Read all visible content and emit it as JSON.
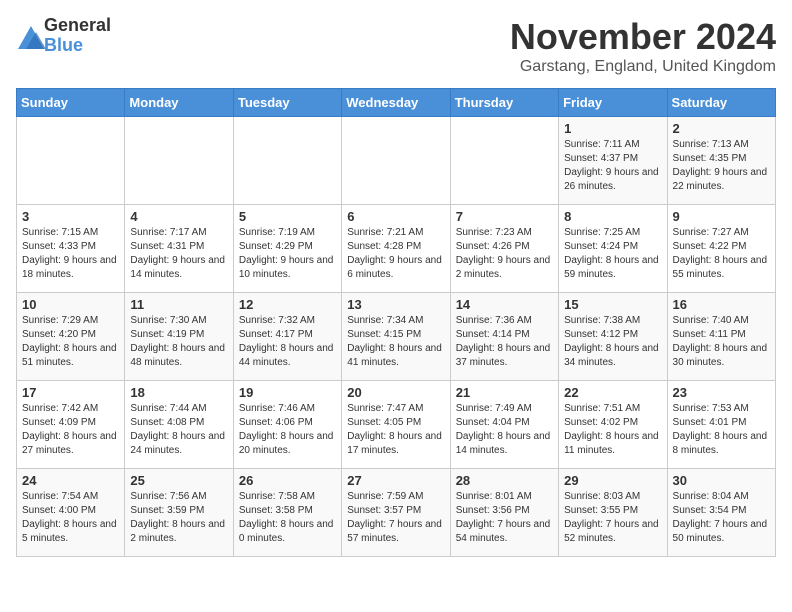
{
  "logo": {
    "general": "General",
    "blue": "Blue"
  },
  "header": {
    "month": "November 2024",
    "location": "Garstang, England, United Kingdom"
  },
  "weekdays": [
    "Sunday",
    "Monday",
    "Tuesday",
    "Wednesday",
    "Thursday",
    "Friday",
    "Saturday"
  ],
  "weeks": [
    [
      {
        "day": "",
        "sunrise": "",
        "sunset": "",
        "daylight": ""
      },
      {
        "day": "",
        "sunrise": "",
        "sunset": "",
        "daylight": ""
      },
      {
        "day": "",
        "sunrise": "",
        "sunset": "",
        "daylight": ""
      },
      {
        "day": "",
        "sunrise": "",
        "sunset": "",
        "daylight": ""
      },
      {
        "day": "",
        "sunrise": "",
        "sunset": "",
        "daylight": ""
      },
      {
        "day": "1",
        "sunrise": "Sunrise: 7:11 AM",
        "sunset": "Sunset: 4:37 PM",
        "daylight": "Daylight: 9 hours and 26 minutes."
      },
      {
        "day": "2",
        "sunrise": "Sunrise: 7:13 AM",
        "sunset": "Sunset: 4:35 PM",
        "daylight": "Daylight: 9 hours and 22 minutes."
      }
    ],
    [
      {
        "day": "3",
        "sunrise": "Sunrise: 7:15 AM",
        "sunset": "Sunset: 4:33 PM",
        "daylight": "Daylight: 9 hours and 18 minutes."
      },
      {
        "day": "4",
        "sunrise": "Sunrise: 7:17 AM",
        "sunset": "Sunset: 4:31 PM",
        "daylight": "Daylight: 9 hours and 14 minutes."
      },
      {
        "day": "5",
        "sunrise": "Sunrise: 7:19 AM",
        "sunset": "Sunset: 4:29 PM",
        "daylight": "Daylight: 9 hours and 10 minutes."
      },
      {
        "day": "6",
        "sunrise": "Sunrise: 7:21 AM",
        "sunset": "Sunset: 4:28 PM",
        "daylight": "Daylight: 9 hours and 6 minutes."
      },
      {
        "day": "7",
        "sunrise": "Sunrise: 7:23 AM",
        "sunset": "Sunset: 4:26 PM",
        "daylight": "Daylight: 9 hours and 2 minutes."
      },
      {
        "day": "8",
        "sunrise": "Sunrise: 7:25 AM",
        "sunset": "Sunset: 4:24 PM",
        "daylight": "Daylight: 8 hours and 59 minutes."
      },
      {
        "day": "9",
        "sunrise": "Sunrise: 7:27 AM",
        "sunset": "Sunset: 4:22 PM",
        "daylight": "Daylight: 8 hours and 55 minutes."
      }
    ],
    [
      {
        "day": "10",
        "sunrise": "Sunrise: 7:29 AM",
        "sunset": "Sunset: 4:20 PM",
        "daylight": "Daylight: 8 hours and 51 minutes."
      },
      {
        "day": "11",
        "sunrise": "Sunrise: 7:30 AM",
        "sunset": "Sunset: 4:19 PM",
        "daylight": "Daylight: 8 hours and 48 minutes."
      },
      {
        "day": "12",
        "sunrise": "Sunrise: 7:32 AM",
        "sunset": "Sunset: 4:17 PM",
        "daylight": "Daylight: 8 hours and 44 minutes."
      },
      {
        "day": "13",
        "sunrise": "Sunrise: 7:34 AM",
        "sunset": "Sunset: 4:15 PM",
        "daylight": "Daylight: 8 hours and 41 minutes."
      },
      {
        "day": "14",
        "sunrise": "Sunrise: 7:36 AM",
        "sunset": "Sunset: 4:14 PM",
        "daylight": "Daylight: 8 hours and 37 minutes."
      },
      {
        "day": "15",
        "sunrise": "Sunrise: 7:38 AM",
        "sunset": "Sunset: 4:12 PM",
        "daylight": "Daylight: 8 hours and 34 minutes."
      },
      {
        "day": "16",
        "sunrise": "Sunrise: 7:40 AM",
        "sunset": "Sunset: 4:11 PM",
        "daylight": "Daylight: 8 hours and 30 minutes."
      }
    ],
    [
      {
        "day": "17",
        "sunrise": "Sunrise: 7:42 AM",
        "sunset": "Sunset: 4:09 PM",
        "daylight": "Daylight: 8 hours and 27 minutes."
      },
      {
        "day": "18",
        "sunrise": "Sunrise: 7:44 AM",
        "sunset": "Sunset: 4:08 PM",
        "daylight": "Daylight: 8 hours and 24 minutes."
      },
      {
        "day": "19",
        "sunrise": "Sunrise: 7:46 AM",
        "sunset": "Sunset: 4:06 PM",
        "daylight": "Daylight: 8 hours and 20 minutes."
      },
      {
        "day": "20",
        "sunrise": "Sunrise: 7:47 AM",
        "sunset": "Sunset: 4:05 PM",
        "daylight": "Daylight: 8 hours and 17 minutes."
      },
      {
        "day": "21",
        "sunrise": "Sunrise: 7:49 AM",
        "sunset": "Sunset: 4:04 PM",
        "daylight": "Daylight: 8 hours and 14 minutes."
      },
      {
        "day": "22",
        "sunrise": "Sunrise: 7:51 AM",
        "sunset": "Sunset: 4:02 PM",
        "daylight": "Daylight: 8 hours and 11 minutes."
      },
      {
        "day": "23",
        "sunrise": "Sunrise: 7:53 AM",
        "sunset": "Sunset: 4:01 PM",
        "daylight": "Daylight: 8 hours and 8 minutes."
      }
    ],
    [
      {
        "day": "24",
        "sunrise": "Sunrise: 7:54 AM",
        "sunset": "Sunset: 4:00 PM",
        "daylight": "Daylight: 8 hours and 5 minutes."
      },
      {
        "day": "25",
        "sunrise": "Sunrise: 7:56 AM",
        "sunset": "Sunset: 3:59 PM",
        "daylight": "Daylight: 8 hours and 2 minutes."
      },
      {
        "day": "26",
        "sunrise": "Sunrise: 7:58 AM",
        "sunset": "Sunset: 3:58 PM",
        "daylight": "Daylight: 8 hours and 0 minutes."
      },
      {
        "day": "27",
        "sunrise": "Sunrise: 7:59 AM",
        "sunset": "Sunset: 3:57 PM",
        "daylight": "Daylight: 7 hours and 57 minutes."
      },
      {
        "day": "28",
        "sunrise": "Sunrise: 8:01 AM",
        "sunset": "Sunset: 3:56 PM",
        "daylight": "Daylight: 7 hours and 54 minutes."
      },
      {
        "day": "29",
        "sunrise": "Sunrise: 8:03 AM",
        "sunset": "Sunset: 3:55 PM",
        "daylight": "Daylight: 7 hours and 52 minutes."
      },
      {
        "day": "30",
        "sunrise": "Sunrise: 8:04 AM",
        "sunset": "Sunset: 3:54 PM",
        "daylight": "Daylight: 7 hours and 50 minutes."
      }
    ]
  ]
}
